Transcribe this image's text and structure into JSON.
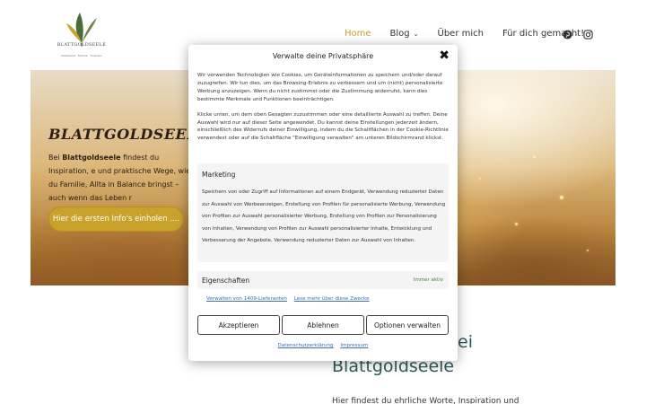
{
  "header": {
    "logo_text": "BLATTGOLDSEELE",
    "logo_subtitle": "Selbstwert · Familie · Finanzen",
    "nav": [
      {
        "label": "Home",
        "active": true
      },
      {
        "label": "Blog",
        "has_dropdown": true
      },
      {
        "label": "Über mich"
      },
      {
        "label": "Für dich gemacht!"
      }
    ],
    "social": [
      {
        "icon": "pinterest-icon"
      },
      {
        "icon": "instagram-icon"
      }
    ],
    "accent_color": "#c9a22c"
  },
  "hero": {
    "title": "BLATTGOLDSEELE",
    "text_prefix": "Bei ",
    "text_bold": "Blattgoldseele",
    "text_rest": " findest du Inspiration, e und praktische Wege, wie du Familie, Allta in Balance bringst – auch wenn das Leben r",
    "button_label": "Hier die ersten Info's einholen ...."
  },
  "welcome": {
    "line1": "ei",
    "line2": "Blattgoldseele",
    "sub": "Hier findest du ehrliche Worte, Inspiration und"
  },
  "consent": {
    "title": "Verwalte deine Privatsphäre",
    "paragraph1": "Wir verwenden Technologien wie Cookies, um Geräteinformationen zu speichern und/oder darauf zuzugreifen. Wir tun dies, um das Browsing-Erlebnis zu verbessern und um (nicht) personalisierte Werbung anzuzeigen. Wenn du nicht zustimmst oder die Zustimmung widerrufst, kann dies bestimmte Merkmale und Funktionen beeinträchtigen.",
    "paragraph2": "Klicke unten, um dem oben Gesagten zuzustimmen oder eine detaillierte Auswahl zu treffen. Deine Auswahl wird nur auf dieser Seite angewendet. Du kannst deine Einstellungen jederzeit ändern, einschließlich des Widerrufs deiner Einwilligung, indem du die Schaltflächen in der Cookie-Richtlinie verwendest oder auf die Schaltfläche \"Einwilligung verwalten\" am unteren Bildschirmrand klickst.",
    "marketing_title": "Marketing",
    "marketing_desc": "Speichern von oder Zugriff auf Informationen auf einem Endgerät, Verwendung reduzierter Daten zur Auswahl von Werbeanzeigen, Erstellung von Profilen für personalisierte Werbung, Verwendung von Profilen zur Auswahl personalisierter Werbung, Erstellung von Profilen zur Personalisierung von Inhalten, Verwendung von Profilen zur Auswahl personalisierter Inhalte, Entwicklung und Verbesserung der Angebote, Verwendung reduzierter Daten zur Auswahl von Inhalten.",
    "properties_title": "Eigenschaften",
    "properties_status": "Immer aktiv",
    "link_vendors": "Verwalten von 1409-Lieferanten",
    "link_more": "Lese mehr über diese Zwecke",
    "btn_accept": "Akzeptieren",
    "btn_decline": "Ablehnen",
    "btn_options": "Optionen verwalten",
    "footer_privacy": "Datenschutzerklärung",
    "footer_imprint": "Impressum"
  }
}
